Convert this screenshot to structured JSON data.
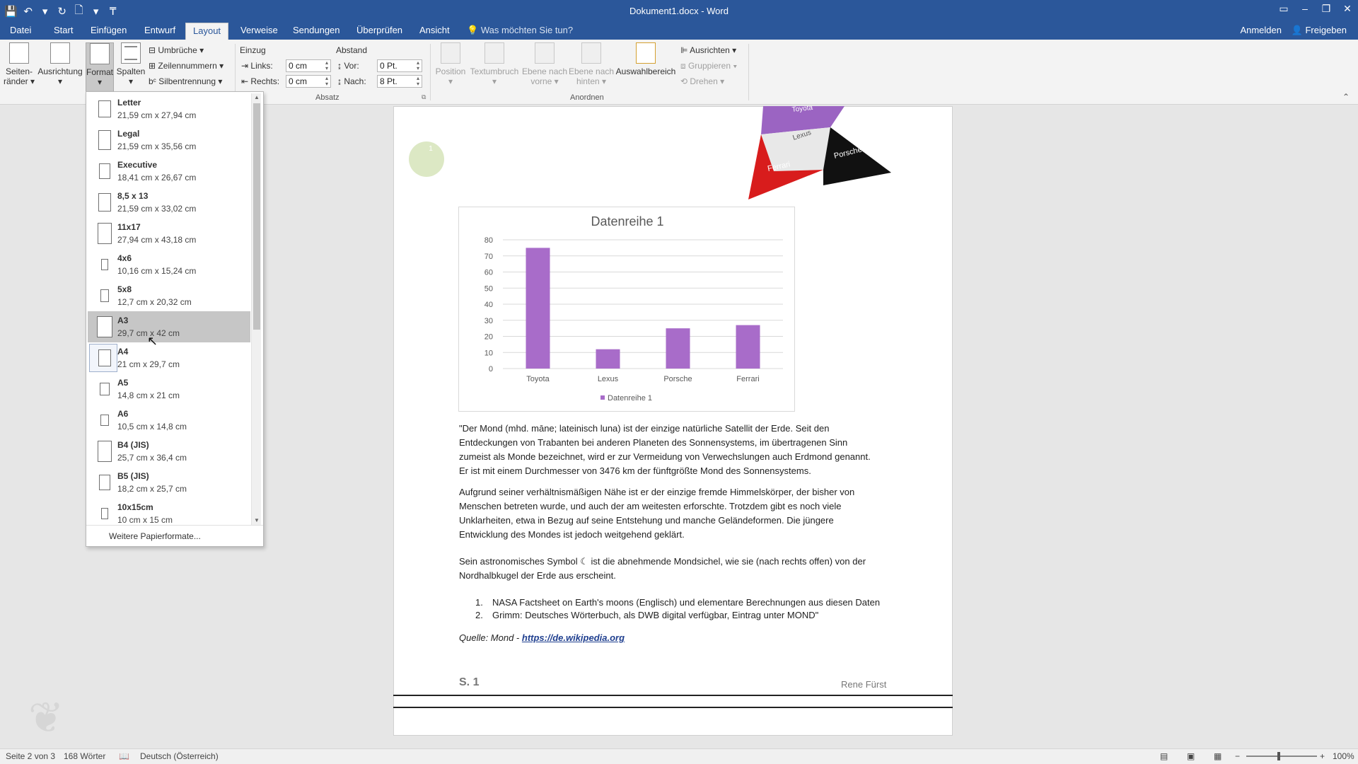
{
  "window": {
    "title": "Dokument1.docx - Word",
    "controls": [
      "▭",
      "–",
      "❐",
      "✕"
    ]
  },
  "qat": [
    "💾",
    "↶",
    "▾",
    "↻",
    "🗋",
    "▾",
    "₸"
  ],
  "tabs": [
    "Datei",
    "Start",
    "Einfügen",
    "Entwurf",
    "Layout",
    "Verweise",
    "Sendungen",
    "Überprüfen",
    "Ansicht"
  ],
  "active_tab": "Layout",
  "tell_me": "Was möchten Sie tun?",
  "sign_in": "Anmelden",
  "share": "Freigeben",
  "ribbon": {
    "seitenraender": "Seiten-\nränder ▾",
    "ausrichtung": "Ausrichtung\n▾",
    "format": "Format\n▾",
    "spalten": "Spalten\n▾",
    "umbrueche": "Umbrüche ▾",
    "zeilennummern": "Zeilennummern ▾",
    "silbentrennung": "Silbentrennung ▾",
    "einzug": "Einzug",
    "abstand": "Abstand",
    "links_label": "Links:",
    "links_value": "0 cm",
    "rechts_label": "Rechts:",
    "rechts_value": "0 cm",
    "vor_label": "Vor:",
    "vor_value": "0 Pt.",
    "nach_label": "Nach:",
    "nach_value": "8 Pt.",
    "absatz": "Absatz",
    "position": "Position\n▾",
    "textumbruch": "Textumbruch\n▾",
    "ebene_vorne": "Ebene nach\nvorne ▾",
    "ebene_hinten": "Ebene nach\nhinten ▾",
    "auswahlbereich": "Auswahlbereich",
    "ausrichten": "Ausrichten ▾",
    "gruppieren": "Gruppieren ▾",
    "drehen": "Drehen ▾",
    "anordnen": "Anordnen"
  },
  "dropdown": {
    "items": [
      {
        "name": "Letter",
        "size": "21,59  cm x 27,94  cm"
      },
      {
        "name": "Legal",
        "size": "21,59  cm x 35,56  cm"
      },
      {
        "name": "Executive",
        "size": "18,41  cm x 26,67  cm"
      },
      {
        "name": "8,5 x 13",
        "size": "21,59  cm x 33,02  cm"
      },
      {
        "name": "11x17",
        "size": "27,94  cm x 43,18  cm"
      },
      {
        "name": "4x6",
        "size": "10,16  cm x 15,24  cm"
      },
      {
        "name": "5x8",
        "size": "12,7  cm x 20,32  cm"
      },
      {
        "name": "A3",
        "size": "29,7  cm x 42  cm"
      },
      {
        "name": "A4",
        "size": "21  cm x 29,7  cm"
      },
      {
        "name": "A5",
        "size": "14,8  cm x 21  cm"
      },
      {
        "name": "A6",
        "size": "10,5  cm x 14,8  cm"
      },
      {
        "name": "B4 (JIS)",
        "size": "25,7  cm x 36,4  cm"
      },
      {
        "name": "B5 (JIS)",
        "size": "18,2  cm x 25,7  cm"
      },
      {
        "name": "10x15cm",
        "size": "10  cm x 15  cm"
      }
    ],
    "more": "Weitere Papierformate...",
    "hovered": "A3",
    "selected": "A4"
  },
  "chart_data": {
    "type": "bar",
    "title": "Datenreihe 1",
    "categories": [
      "Toyota",
      "Lexus",
      "Porsche",
      "Ferrari"
    ],
    "series": [
      {
        "name": "Datenreihe 1",
        "values": [
          75,
          12,
          25,
          27
        ]
      }
    ],
    "ylim": [
      0,
      80
    ],
    "yticks": [
      "0",
      "10",
      "20",
      "30",
      "40",
      "50",
      "60",
      "70",
      "80"
    ],
    "grid": true,
    "legend": "bottom",
    "color": "#a86cc9"
  },
  "pyramid_labels": [
    "Toyota",
    "Lexus",
    "Ferrari",
    "Porsche"
  ],
  "circle_label": "1",
  "body": {
    "p1": "\"Der Mond (mhd. māne; lateinisch luna) ist der einzige natürliche Satellit der Erde. Seit den\nEntdeckungen von Trabanten bei anderen Planeten des Sonnensystems, im übertragenen Sinn\nzumeist als Monde bezeichnet, wird er zur Vermeidung von Verwechslungen auch Erdmond genannt.\nEr ist mit einem Durchmesser von 3476 km der fünftgrößte Mond des Sonnensystems.",
    "p2": "Aufgrund seiner verhältnismäßigen Nähe ist er der einzige fremde Himmelskörper, der bisher von\nMenschen betreten wurde, und auch der am weitesten erforschte. Trotzdem gibt es noch viele\nUnklarheiten, etwa in Bezug auf seine Entstehung und manche Geländeformen. Die jüngere\nEntwicklung des Mondes ist jedoch weitgehend geklärt.",
    "p3": "Sein astronomisches Symbol ☾ ist die abnehmende Mondsichel, wie sie (nach rechts offen) von der\nNordhalbkugel der Erde aus erscheint.",
    "list": [
      "NASA Factsheet on Earth's moons (Englisch) und elementare Berechnungen aus diesen Daten",
      "Grimm: Deutsches Wörterbuch, als DWB digital verfügbar, Eintrag unter MOND\""
    ],
    "source_prefix": "Quelle: Mond - ",
    "source_link": "https://de.wikipedia.org"
  },
  "footer": {
    "page_label": "S. 1",
    "author": "Rene Fürst"
  },
  "status": {
    "page": "Seite 2 von 3",
    "words": "168 Wörter",
    "language": "Deutsch (Österreich)",
    "zoom": "100%"
  },
  "colors": {
    "word_blue": "#2b579a",
    "bar": "#a86cc9"
  }
}
